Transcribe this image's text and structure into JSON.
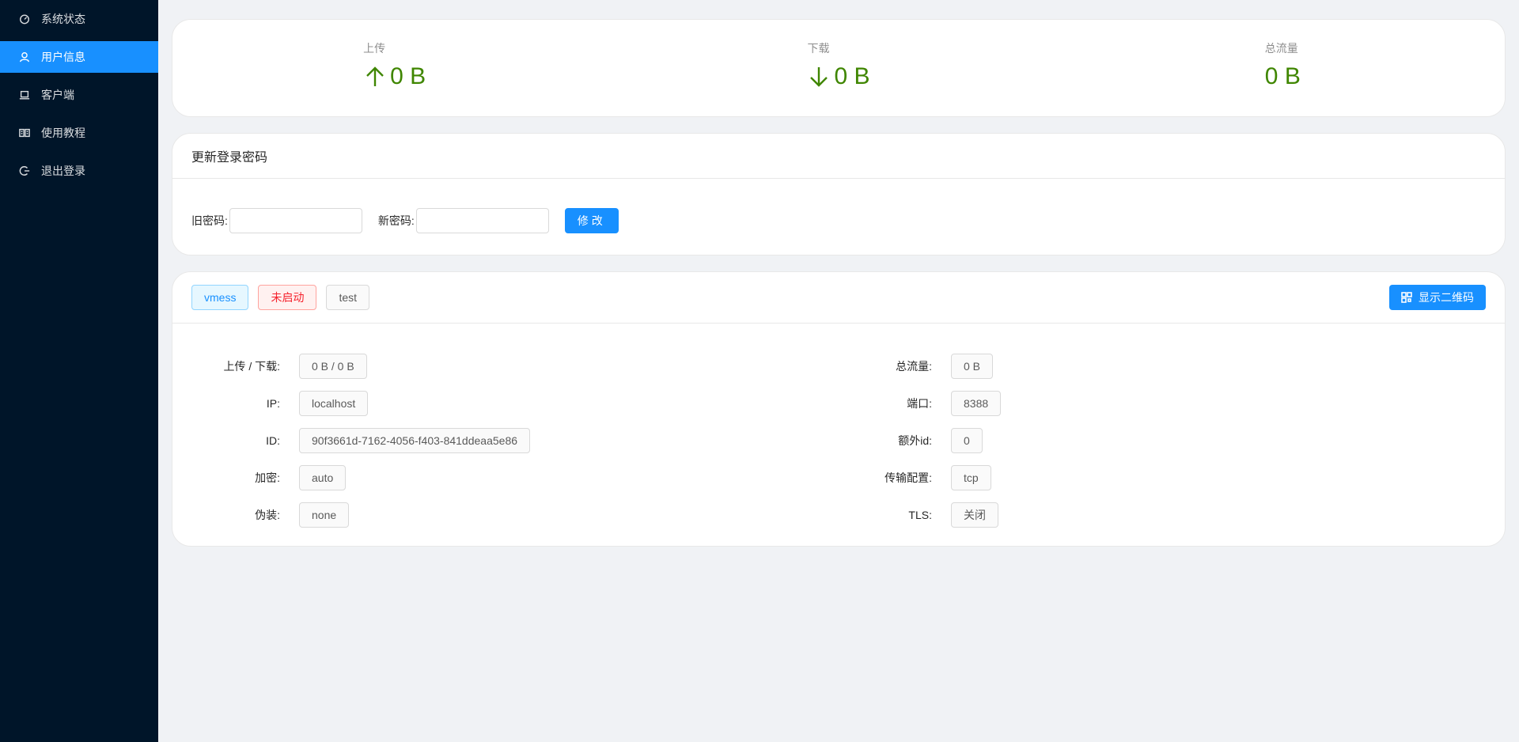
{
  "sidebar": {
    "items": [
      {
        "label": "系统状态",
        "icon": "dashboard-icon"
      },
      {
        "label": "用户信息",
        "icon": "user-icon",
        "active": true
      },
      {
        "label": "客户端",
        "icon": "laptop-icon"
      },
      {
        "label": "使用教程",
        "icon": "book-icon"
      },
      {
        "label": "退出登录",
        "icon": "logout-icon"
      }
    ]
  },
  "stats": {
    "upload": {
      "title": "上传",
      "value": "0 B"
    },
    "download": {
      "title": "下载",
      "value": "0 B"
    },
    "total": {
      "title": "总流量",
      "value": "0 B"
    }
  },
  "password": {
    "title": "更新登录密码",
    "old_label": "旧密码:",
    "new_label": "新密码:",
    "submit": "修改"
  },
  "config": {
    "tags": [
      "vmess",
      "未启动",
      "test"
    ],
    "qr_button": "显示二维码",
    "left": [
      {
        "label": "上传 / 下载:",
        "value": "0 B / 0 B"
      },
      {
        "label": "IP:",
        "value": "localhost"
      },
      {
        "label": "ID:",
        "value": "90f3661d-7162-4056-f403-841ddeaa5e86"
      },
      {
        "label": "加密:",
        "value": "auto"
      },
      {
        "label": "伪装:",
        "value": "none"
      }
    ],
    "right": [
      {
        "label": "总流量:",
        "value": "0 B"
      },
      {
        "label": "端口:",
        "value": "8388"
      },
      {
        "label": "额外id:",
        "value": "0"
      },
      {
        "label": "传输配置:",
        "value": "tcp"
      },
      {
        "label": "TLS:",
        "value": "关闭"
      }
    ]
  },
  "colors": {
    "sidebar_bg": "#001529",
    "accent": "#1890ff",
    "stat_green": "#3f8600"
  }
}
